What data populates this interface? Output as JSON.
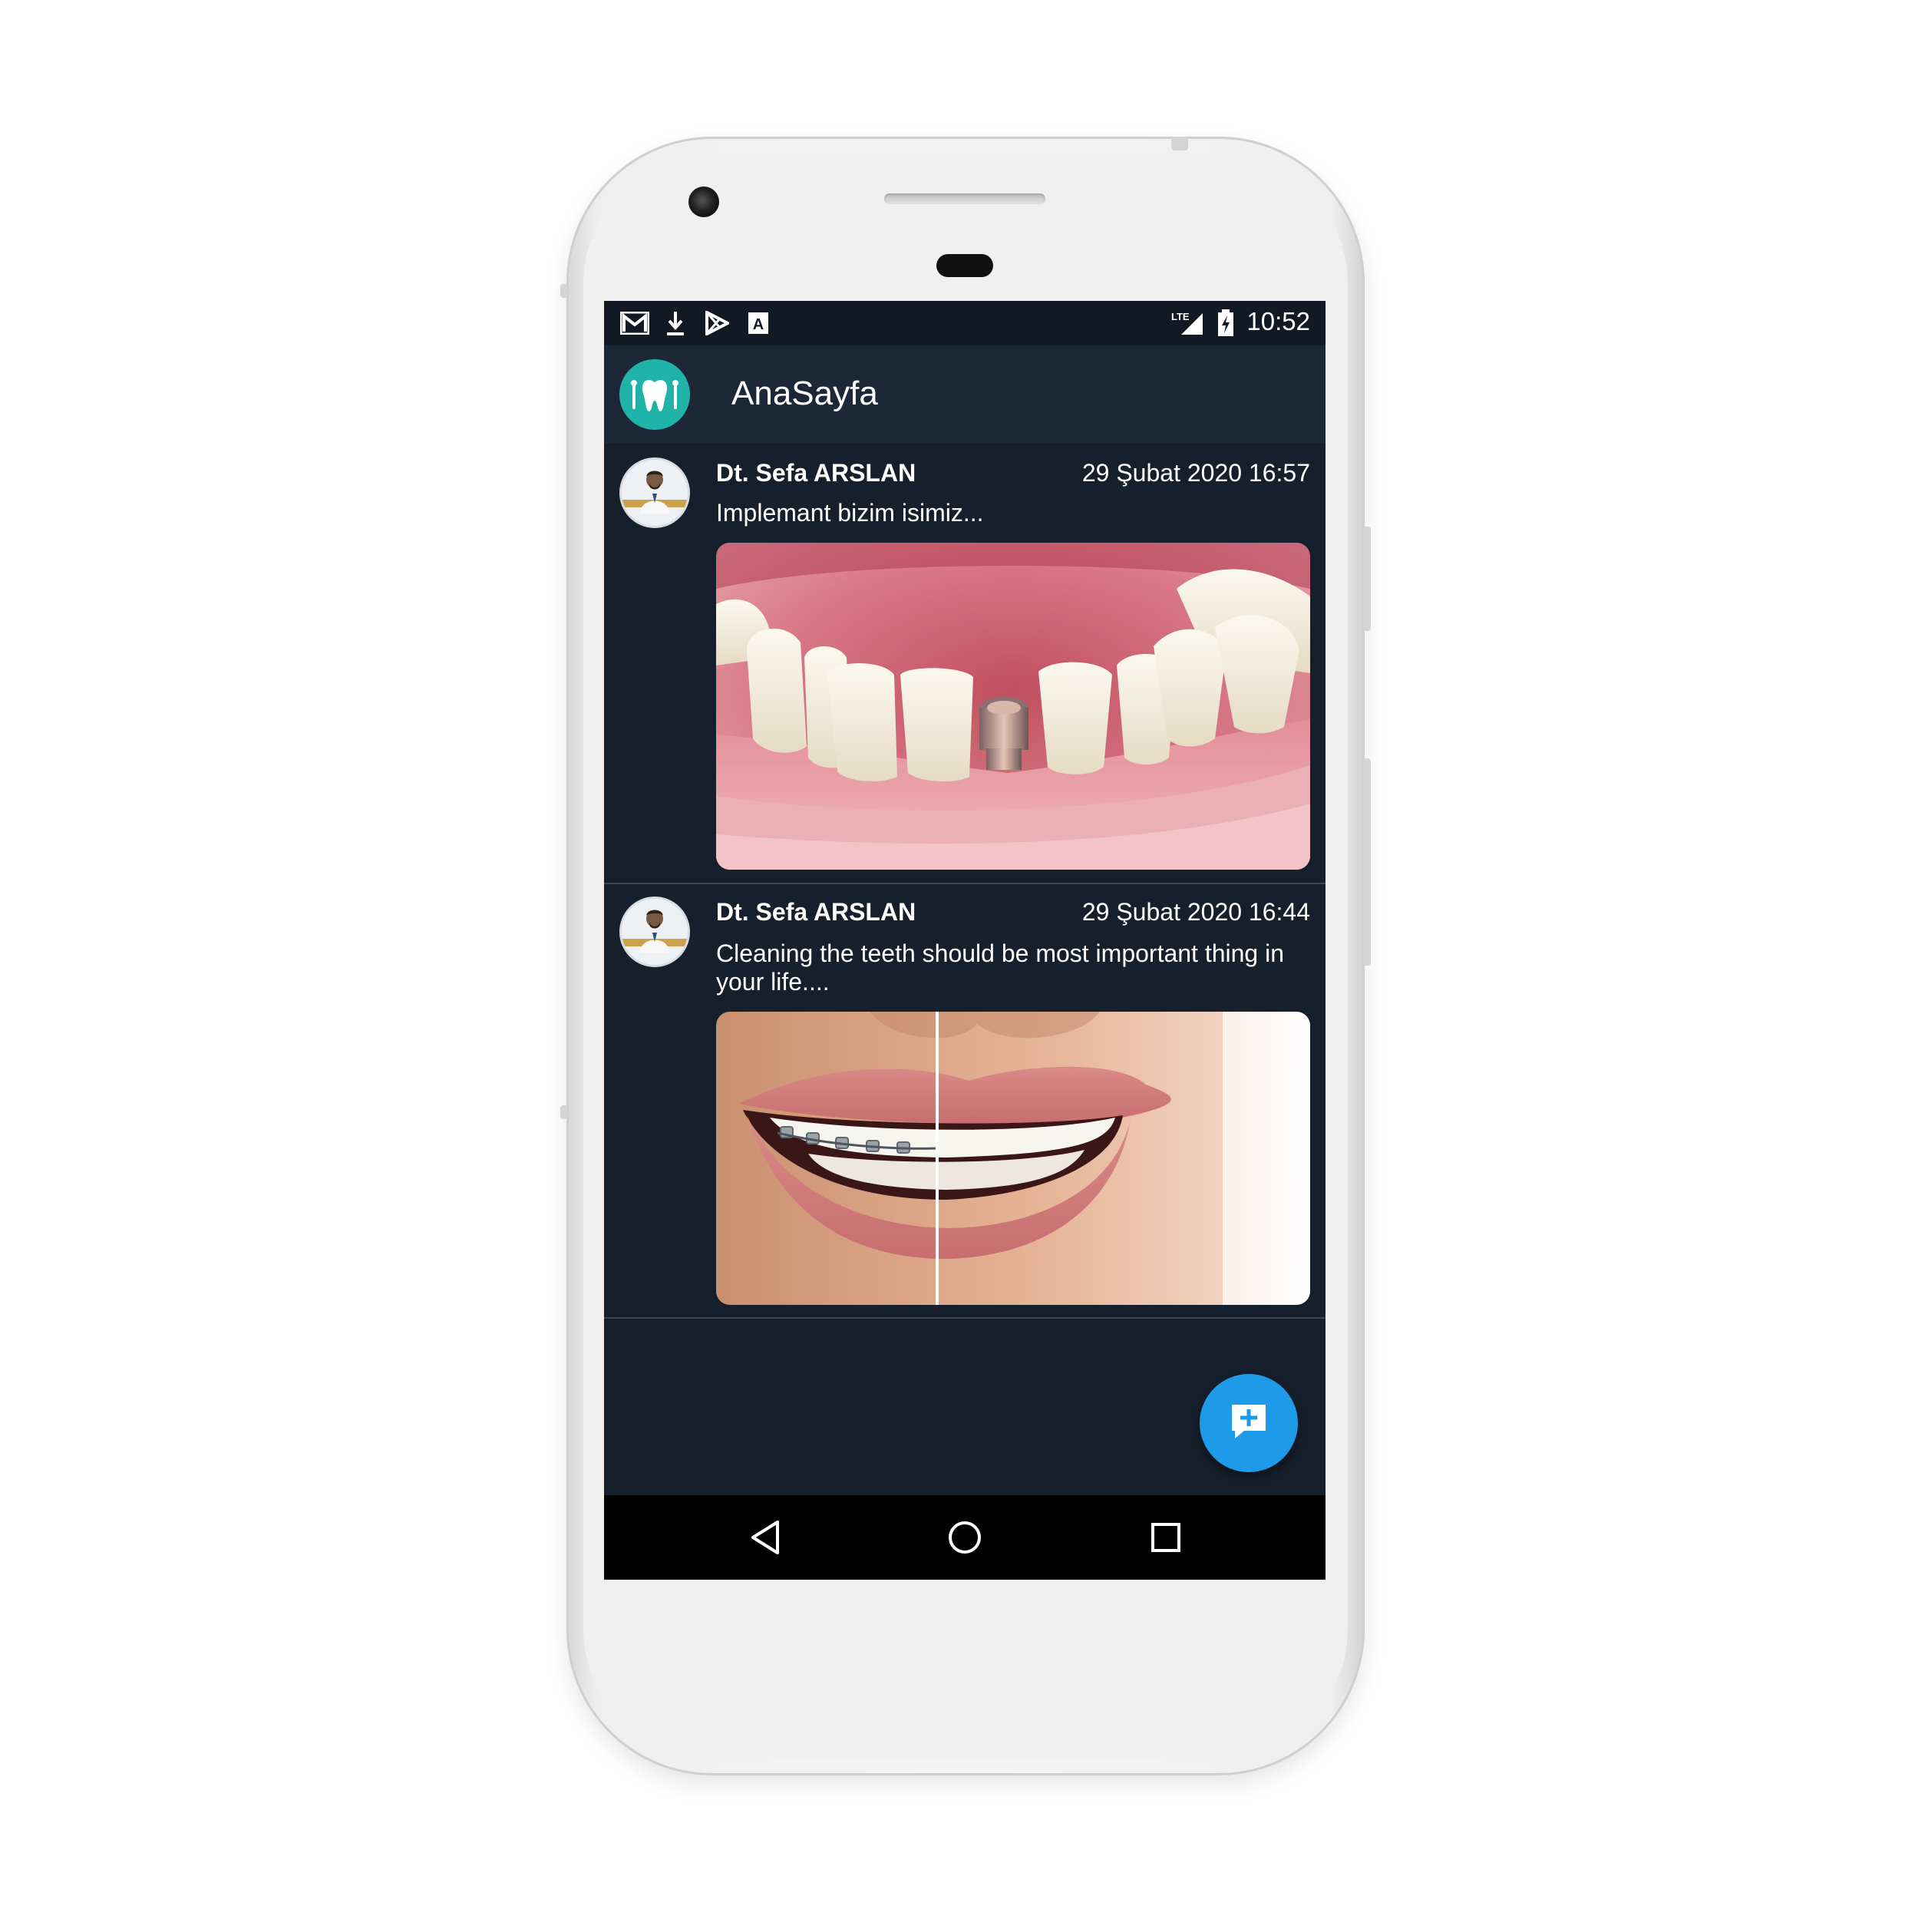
{
  "status_bar": {
    "time": "10:52",
    "network_label": "LTE",
    "left_icons": [
      "gmail-icon",
      "download-icon",
      "play-store-icon",
      "keyboard-a-icon"
    ],
    "right_icons": [
      "signal-icon",
      "battery-charging-icon"
    ]
  },
  "app_bar": {
    "title": "AnaSayfa",
    "logo": "tooth-logo-icon"
  },
  "posts": [
    {
      "author": "Dt. Sefa ARSLAN",
      "date": "29 Şubat 2020 16:57",
      "text": "Implemant bizim isimiz...",
      "image": "dental-implant-photo"
    },
    {
      "author": "Dt. Sefa ARSLAN",
      "date": "29 Şubat 2020 16:44",
      "text": "Cleaning the teeth should be most important thing in your life....",
      "image": "braces-before-after-smile-photo"
    }
  ],
  "fab": {
    "icon": "add-comment-icon"
  },
  "nav_bar": {
    "icons": [
      "back-icon",
      "home-icon",
      "recents-icon"
    ]
  },
  "colors": {
    "screen_bg": "#16202c",
    "app_bar_bg": "#1c2838",
    "logo_bg": "#1fb3a9",
    "fab_bg": "#1e9be8"
  }
}
